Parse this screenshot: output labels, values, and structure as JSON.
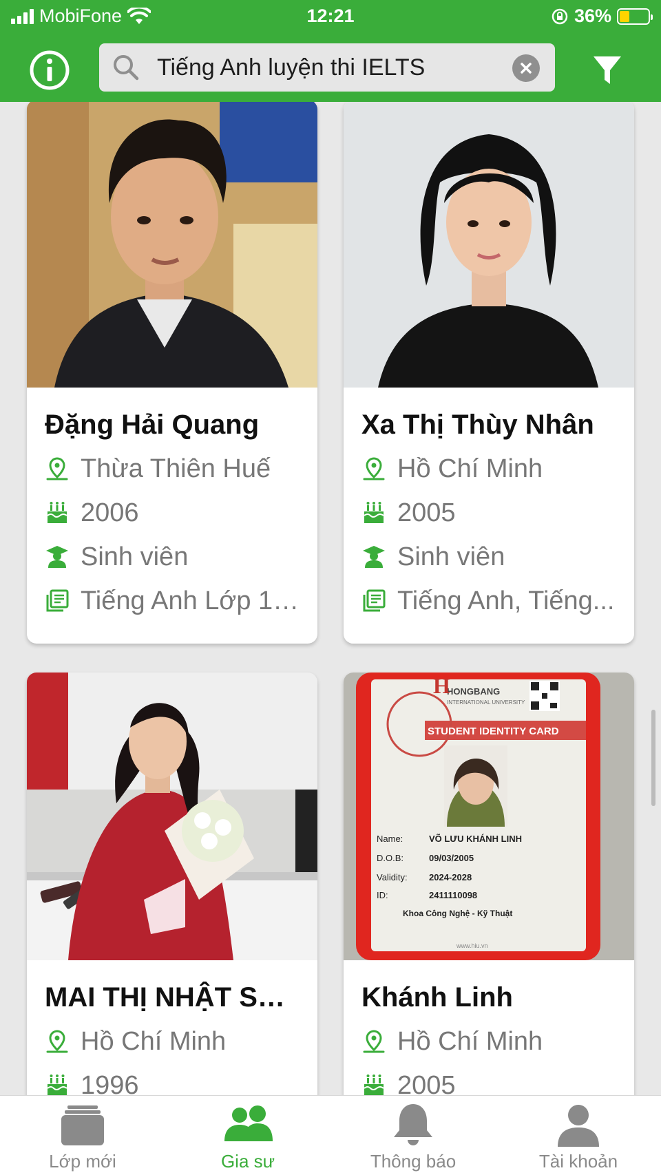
{
  "status_bar": {
    "carrier": "MobiFone",
    "time": "12:21",
    "battery": "36%",
    "battery_level": 0.36
  },
  "header": {
    "search_value": "Tiếng Anh luyện thi IELTS",
    "accent_color": "#3aad3a"
  },
  "tutors": [
    {
      "name": "Đặng Hải Quang",
      "location": "Thừa Thiên Huế",
      "birth_year": "2006",
      "occupation": "Sinh viên",
      "subjects": "Tiếng Anh Lớp 1,..."
    },
    {
      "name": "Xa Thị Thùy Nhân",
      "location": "Hồ Chí Minh",
      "birth_year": "2005",
      "occupation": "Sinh viên",
      "subjects": "Tiếng Anh, Tiếng..."
    },
    {
      "name": "MAI THỊ NHẬT SA...",
      "location": "Hồ Chí Minh",
      "birth_year": "1996"
    },
    {
      "name": "Khánh Linh",
      "location": "Hồ Chí Minh",
      "birth_year": "2005",
      "id_card": {
        "school": "HONGBANG",
        "school_sub": "INTERNATIONAL UNIVERSITY",
        "title": "STUDENT IDENTITY CARD",
        "name_label": "Name:",
        "name_value": "VÕ LƯU KHÁNH LINH",
        "dob_label": "D.O.B:",
        "dob_value": "09/03/2005",
        "validity_label": "Validity:",
        "validity_value": "2024-2028",
        "id_label": "ID:",
        "id_value": "2411110098",
        "faculty": "Khoa Công Nghệ - Kỹ Thuật",
        "website": "www.hiu.vn"
      }
    }
  ],
  "bottom_nav": [
    {
      "label": "Lớp mới",
      "icon": "classes-icon"
    },
    {
      "label": "Gia sư",
      "icon": "tutors-icon",
      "active": true
    },
    {
      "label": "Thông báo",
      "icon": "bell-icon"
    },
    {
      "label": "Tài khoản",
      "icon": "account-icon"
    }
  ]
}
